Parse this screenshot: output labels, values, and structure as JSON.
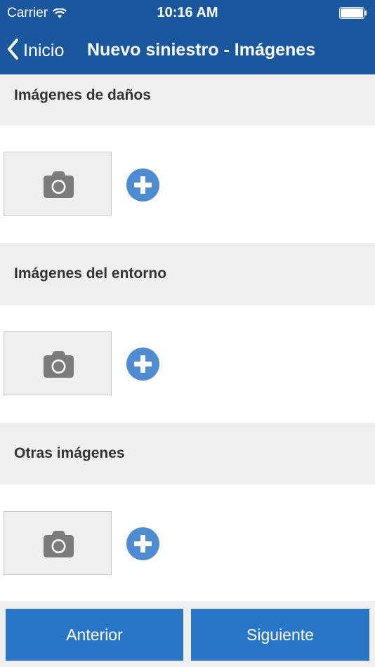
{
  "status_bar": {
    "carrier": "Carrier",
    "time": "10:16 AM"
  },
  "nav": {
    "back_label": "Inicio",
    "title": "Nuevo siniestro - Imágenes"
  },
  "sections": [
    {
      "title": "Imágenes de daños"
    },
    {
      "title": "Imágenes del entorno"
    },
    {
      "title": "Otras imágenes"
    }
  ],
  "footer": {
    "previous_label": "Anterior",
    "next_label": "Siguiente"
  },
  "colors": {
    "header_bg": "#1a579e",
    "button_bg": "#2976c9",
    "add_icon": "#4f8bd0",
    "camera_icon": "#7b7b7b",
    "section_bg": "#efefef"
  },
  "icons": {
    "back": "chevron-left-icon",
    "camera": "camera-icon",
    "add": "plus-circle-icon",
    "wifi": "wifi-icon",
    "battery": "battery-icon"
  }
}
